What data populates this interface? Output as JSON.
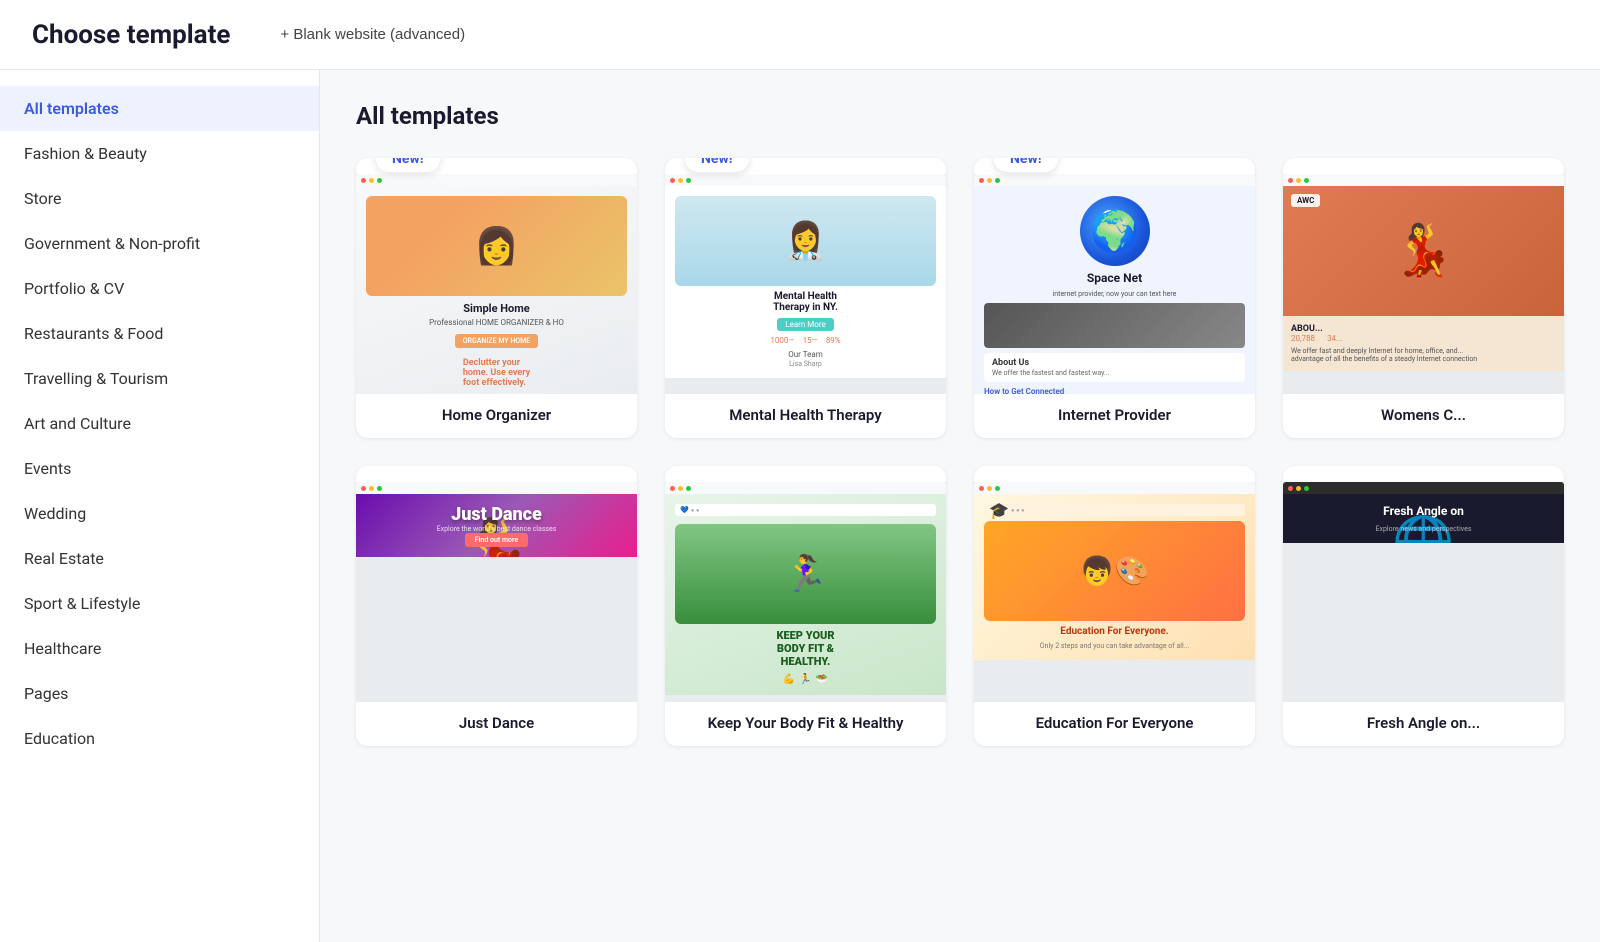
{
  "header": {
    "title": "Choose template",
    "blank_website_label": "+ Blank website (advanced)"
  },
  "sidebar": {
    "items": [
      {
        "id": "all-templates",
        "label": "All templates",
        "active": true
      },
      {
        "id": "fashion-beauty",
        "label": "Fashion & Beauty",
        "active": false
      },
      {
        "id": "store",
        "label": "Store",
        "active": false
      },
      {
        "id": "government-non-profit",
        "label": "Government & Non-profit",
        "active": false
      },
      {
        "id": "portfolio-cv",
        "label": "Portfolio & CV",
        "active": false
      },
      {
        "id": "restaurants-food",
        "label": "Restaurants & Food",
        "active": false
      },
      {
        "id": "travelling-tourism",
        "label": "Travelling & Tourism",
        "active": false
      },
      {
        "id": "art-culture",
        "label": "Art and Culture",
        "active": false
      },
      {
        "id": "events",
        "label": "Events",
        "active": false
      },
      {
        "id": "wedding",
        "label": "Wedding",
        "active": false
      },
      {
        "id": "real-estate",
        "label": "Real Estate",
        "active": false
      },
      {
        "id": "sport-lifestyle",
        "label": "Sport & Lifestyle",
        "active": false
      },
      {
        "id": "healthcare",
        "label": "Healthcare",
        "active": false
      },
      {
        "id": "pages",
        "label": "Pages",
        "active": false
      },
      {
        "id": "education",
        "label": "Education",
        "active": false
      }
    ]
  },
  "content": {
    "section_title": "All templates",
    "row1": [
      {
        "id": "home-organizer",
        "label": "Home Organizer",
        "badge": "New!",
        "thumb_type": "home-organizer"
      },
      {
        "id": "mental-health-therapy",
        "label": "Mental Health Therapy",
        "badge": "New!",
        "thumb_type": "mental-health"
      },
      {
        "id": "internet-provider",
        "label": "Internet Provider",
        "badge": "New!",
        "thumb_type": "internet-provider"
      },
      {
        "id": "womens-clothing",
        "label": "Womens C...",
        "badge": "",
        "thumb_type": "womens"
      }
    ],
    "row2": [
      {
        "id": "just-dance",
        "label": "Just Dance",
        "badge": "",
        "thumb_type": "just-dance"
      },
      {
        "id": "keep-fit",
        "label": "Keep Your Body Fit & Healthy",
        "badge": "",
        "thumb_type": "keep-fit"
      },
      {
        "id": "education-for-everyone",
        "label": "Education For Everyone",
        "badge": "",
        "thumb_type": "education"
      },
      {
        "id": "fresh-angle",
        "label": "Fresh Angle on...",
        "badge": "",
        "thumb_type": "fresh-angle"
      }
    ]
  },
  "icons": {
    "plus": "+",
    "dot_red": "●",
    "dot_yellow": "●",
    "dot_green": "●"
  }
}
